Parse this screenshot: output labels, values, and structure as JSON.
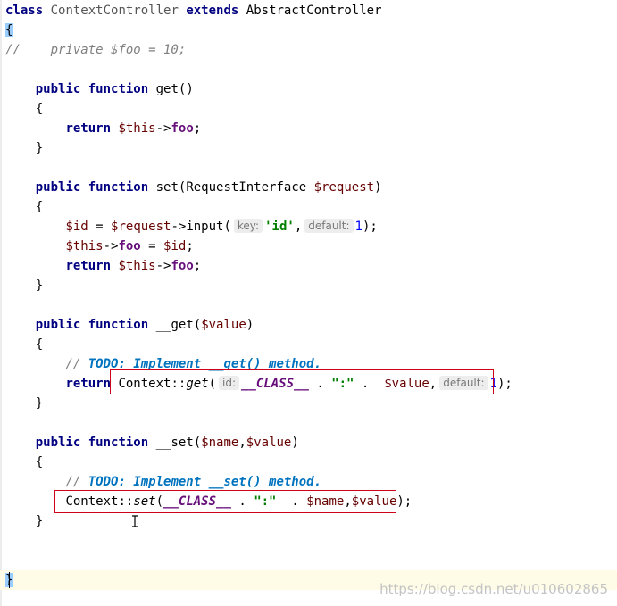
{
  "code": {
    "l1": {
      "kw_class": "class",
      "name": "ContextController",
      "kw_extends": "extends",
      "parent": "AbstractController"
    },
    "l2": {
      "brace": "{"
    },
    "l3": {
      "comment": "//    private $foo = 10;"
    },
    "get_fn": {
      "kw_public": "public",
      "kw_function": "function",
      "name": "get()",
      "open": "{",
      "kw_return": "return",
      "this": "$this",
      "arrow": "->",
      "field": "foo",
      "semi": ";",
      "close": "}"
    },
    "set_fn": {
      "kw_public": "public",
      "kw_function": "function",
      "sig_start": "set(RequestInterface ",
      "param": "$request",
      "sig_end": ")",
      "open": "{",
      "id_var": "$id",
      "assign": " = ",
      "req_var": "$request",
      "input_call": "->input(",
      "hint_key": "key:",
      "str_id": "'id'",
      "comma": ",",
      "hint_default": "default:",
      "num_1": "1",
      "end_call": ");",
      "this": "$this",
      "arrow": "->",
      "field": "foo",
      "assign2": " = ",
      "id_var2": "$id",
      "semi": ";",
      "kw_return": "return",
      "this2": "$this",
      "arrow2": "->",
      "field2": "foo",
      "semi2": ";",
      "close": "}"
    },
    "magic_get": {
      "kw_public": "public",
      "kw_function": "function",
      "name": "__get(",
      "param": "$value",
      "sig_end": ")",
      "open": "{",
      "todo_prefix": "// ",
      "todo_text": "TODO: Implement __get() method.",
      "kw_return": "return",
      "ctx": "Context::",
      "method": "get",
      "paren": "(",
      "hint_id": "id:",
      "const": "__CLASS__",
      "dot1": " . ",
      "str_colon": "\":\"",
      "dot2": " .  ",
      "value_var": "$value",
      "comma": ",",
      "hint_default": "default:",
      "num_1": "1",
      "end_call": ");",
      "close": "}"
    },
    "magic_set": {
      "kw_public": "public",
      "kw_function": "function",
      "name": "__set(",
      "param1": "$name",
      "comma": ",",
      "param2": "$value",
      "sig_end": ")",
      "open": "{",
      "todo_prefix": "// ",
      "todo_text": "TODO: Implement __set() method.",
      "ctx": "Context::",
      "method": "set",
      "paren": "(",
      "const": "__CLASS__",
      "dot1": " . ",
      "str_colon": "\":\"",
      "dot2": "  . ",
      "name_var": "$name",
      "comma2": ",",
      "value_var": "$value",
      "end_call": ");",
      "close": "}"
    },
    "last_brace": "}"
  },
  "watermark": "https://blog.csdn.net/u010602865",
  "colors": {
    "keyword": "#000080",
    "variable": "#660000",
    "field": "#660e7a",
    "string": "#008000",
    "number": "#0000ff",
    "comment": "#808080",
    "todo": "#0073bf",
    "highlight_box": "#d0021b",
    "current_line": "#fefbe6"
  }
}
